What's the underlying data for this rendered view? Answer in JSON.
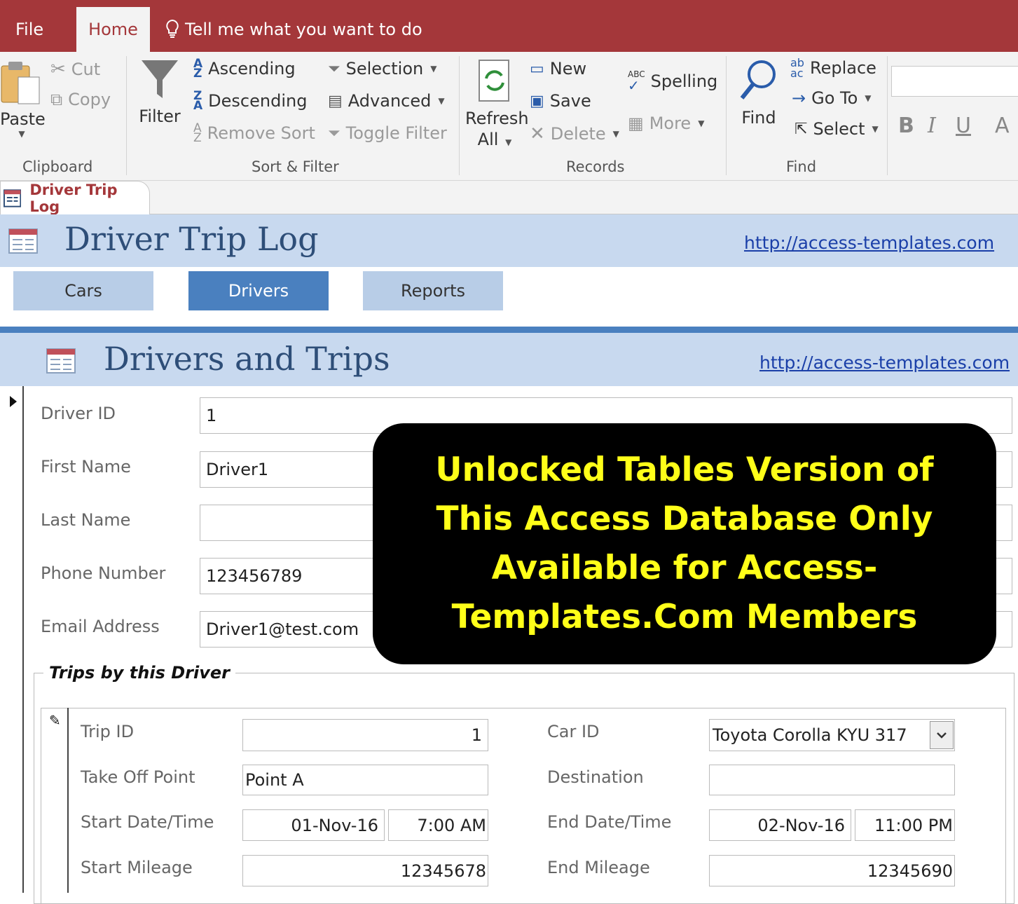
{
  "ribbon_tabs": {
    "file": "File",
    "home": "Home",
    "tell_me": "Tell me what you want to do"
  },
  "clipboard": {
    "paste": "Paste",
    "cut": "Cut",
    "copy": "Copy",
    "group": "Clipboard"
  },
  "sort_filter": {
    "filter": "Filter",
    "ascending": "Ascending",
    "descending": "Descending",
    "remove_sort": "Remove Sort",
    "selection": "Selection",
    "advanced": "Advanced",
    "toggle_filter": "Toggle Filter",
    "group": "Sort & Filter"
  },
  "records": {
    "refresh": "Refresh",
    "refresh_all": "All",
    "new": "New",
    "save": "Save",
    "delete": "Delete",
    "spelling": "Spelling",
    "more": "More",
    "group": "Records"
  },
  "find": {
    "find": "Find",
    "replace": "Replace",
    "goto": "Go To",
    "select": "Select",
    "group": "Find"
  },
  "format": {
    "bold": "B",
    "italic": "I",
    "underline": "U",
    "font_color": "A"
  },
  "doc_tab": "Driver Trip Log",
  "main_header": {
    "title": "Driver Trip Log",
    "link": "http://access-templates.com"
  },
  "nav": {
    "cars": "Cars",
    "drivers": "Drivers",
    "reports": "Reports"
  },
  "sub_header": {
    "title": "Drivers and Trips",
    "link": "http://access-templates.com"
  },
  "driver": {
    "id_label": "Driver ID",
    "id": "1",
    "first_label": "First Name",
    "first": "Driver1",
    "last_label": "Last Name",
    "last": "",
    "phone_label": "Phone Number",
    "phone": "123456789",
    "email_label": "Email Address",
    "email": "Driver1@test.com"
  },
  "trips": {
    "section_title": "Trips by this Driver",
    "trip_id_label": "Trip ID",
    "trip_id": "1",
    "car_id_label": "Car ID",
    "car_id": "Toyota Corolla KYU 317",
    "takeoff_label": "Take Off Point",
    "takeoff": "Point A",
    "dest_label": "Destination",
    "dest": "",
    "start_label": "Start Date/Time",
    "start_date": "01-Nov-16",
    "start_time": "7:00 AM",
    "end_label": "End Date/Time",
    "end_date": "02-Nov-16",
    "end_time": "11:00 PM",
    "start_mileage_label": "Start Mileage",
    "start_mileage": "12345678",
    "end_mileage_label": "End Mileage",
    "end_mileage": "12345690"
  },
  "promo": "Unlocked Tables Version of This Access Database Only Available for Access-Templates.Com Members",
  "colors": {
    "title_bar": "#a4373a",
    "header_band": "#c8d9ef",
    "nav_active": "#4a80bf",
    "promo_text": "#ffff19"
  }
}
